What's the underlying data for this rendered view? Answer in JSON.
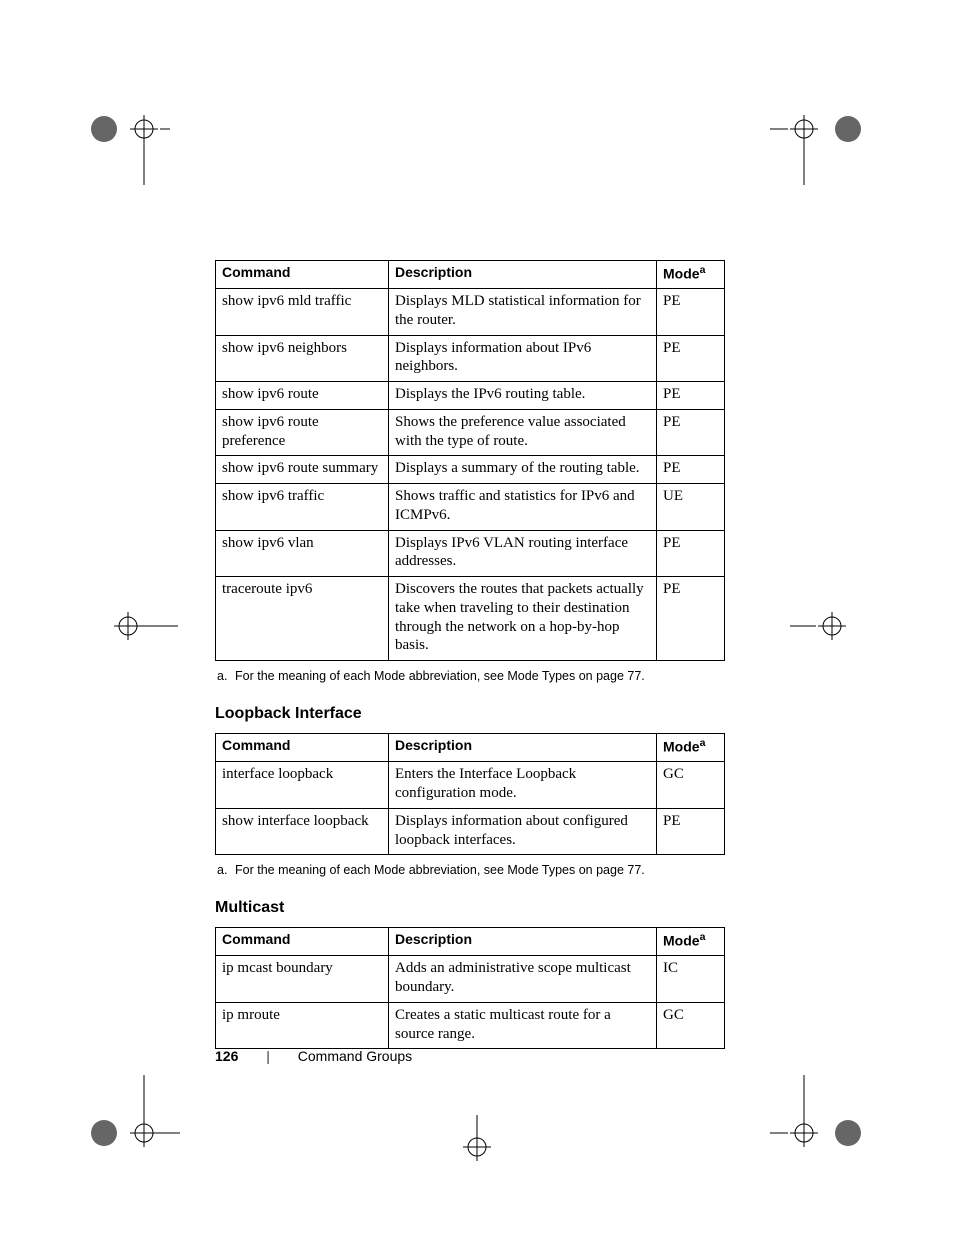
{
  "columns": {
    "cmd": "Command",
    "desc": "Description",
    "mode": "Mode",
    "mode_sup": "a"
  },
  "table1": {
    "rows": [
      {
        "cmd": "show ipv6 mld traffic",
        "desc": "Displays MLD statistical information for the router.",
        "mode": "PE"
      },
      {
        "cmd": "show ipv6 neighbors",
        "desc": "Displays information about IPv6 neighbors.",
        "mode": "PE"
      },
      {
        "cmd": "show ipv6 route",
        "desc": "Displays the IPv6 routing table.",
        "mode": "PE"
      },
      {
        "cmd": "show ipv6 route preference",
        "desc": "Shows the preference value associated with the type of route.",
        "mode": "PE"
      },
      {
        "cmd": "show ipv6 route summary",
        "desc": "Displays a summary of the routing table.",
        "mode": "PE"
      },
      {
        "cmd": "show ipv6 traffic",
        "desc": "Shows traffic and statistics for IPv6 and ICMPv6.",
        "mode": "UE"
      },
      {
        "cmd": "show ipv6 vlan",
        "desc": "Displays IPv6 VLAN routing interface addresses.",
        "mode": "PE"
      },
      {
        "cmd": "traceroute ipv6",
        "desc": "Discovers the routes that packets actually take when traveling to their destination through the network on a hop-by-hop basis.",
        "mode": "PE"
      }
    ]
  },
  "footnote_a": "For the meaning of each Mode abbreviation, see Mode Types on page 77.",
  "footnote_letter": "a.",
  "section2": "Loopback Interface",
  "table2": {
    "rows": [
      {
        "cmd": "interface loopback",
        "desc": "Enters the Interface Loopback configuration mode.",
        "mode": "GC"
      },
      {
        "cmd": "show interface loopback",
        "desc": "Displays information about configured loopback interfaces.",
        "mode": "PE"
      }
    ]
  },
  "section3": "Multicast",
  "table3": {
    "rows": [
      {
        "cmd": "ip mcast boundary",
        "desc": "Adds an administrative scope multicast boundary.",
        "mode": "IC"
      },
      {
        "cmd": "ip mroute",
        "desc": "Creates a static multicast route for a source range.",
        "mode": "GC"
      }
    ]
  },
  "footer": {
    "page": "126",
    "breadcrumb": "Command Groups"
  }
}
